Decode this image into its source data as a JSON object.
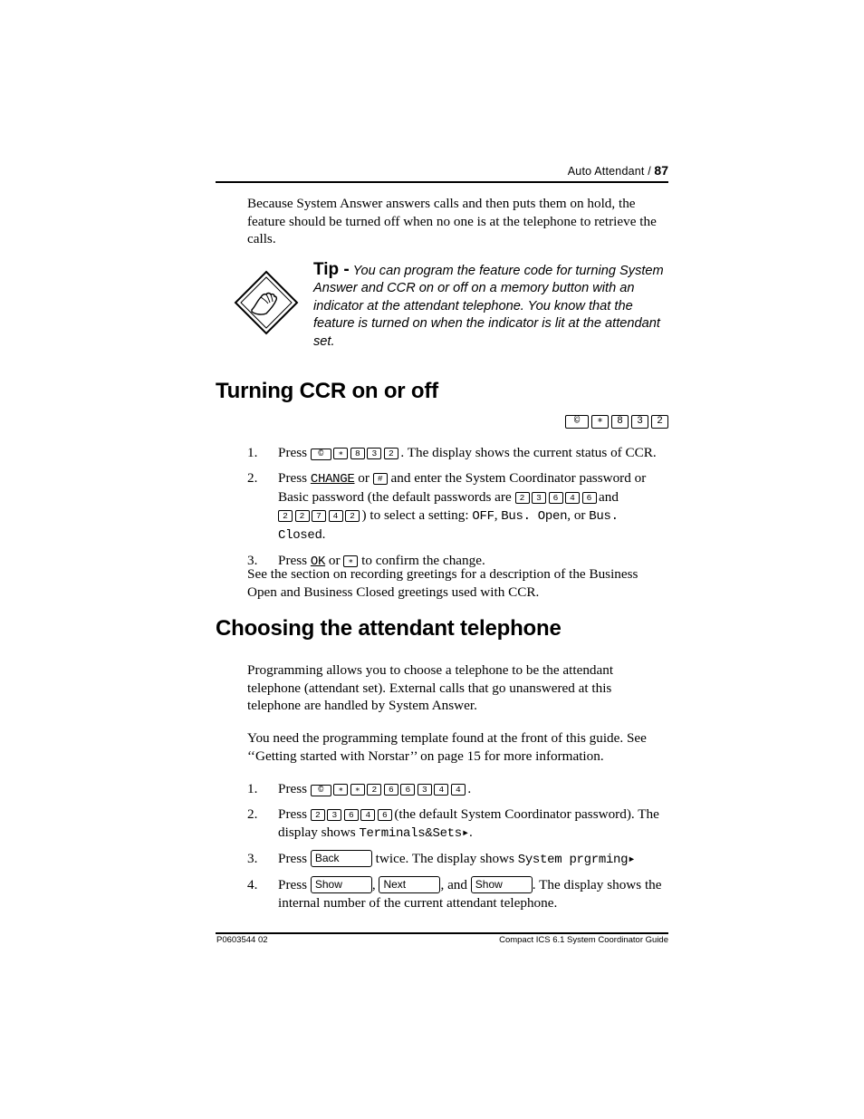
{
  "header": {
    "title": "Auto Attendant /",
    "page_number": "87"
  },
  "intro": {
    "paragraph": "Because System Answer answers calls and then puts them on hold, the feature should be turned off when no one is at the telephone to retrieve the calls."
  },
  "tip": {
    "label": "Tip -",
    "icon": "tip-hand-pointing-icon",
    "text": "You can program the feature code for turning System Answer and CCR on or off on a memory button with an indicator at the attendant telephone. You know that the feature is turned on when the indicator is lit at the attendant set."
  },
  "section_ccr": {
    "heading": "Turning CCR on or off",
    "feature_code_strip": [
      "©",
      "∗",
      "8",
      "3",
      "2"
    ],
    "steps": [
      {
        "num": "1.",
        "press": "Press",
        "keys": [
          "©",
          "∗",
          "8",
          "3",
          "2"
        ],
        "tail": ". The display shows the current status of CCR."
      },
      {
        "num": "2.",
        "press": "Press",
        "softkey": "CHANGE",
        "or": "or",
        "key_hash": "#",
        "mid": "and enter the System Coordinator password or Basic password (the default passwords are",
        "pw1": [
          "2",
          "3",
          "6",
          "4",
          "6"
        ],
        "and": "and",
        "pw2": [
          "2",
          "2",
          "7",
          "4",
          "2"
        ],
        "tail": ") to select a setting:",
        "options": [
          "OFF",
          "Bus. Open",
          "Bus. Closed"
        ],
        "end": "."
      },
      {
        "num": "3.",
        "press": "Press",
        "softkey": "OK",
        "or": "or",
        "key_star": "∗",
        "tail": "to confirm the change."
      }
    ],
    "note": "See the section on recording greetings for a description of the Business Open and Business Closed greetings used with CCR."
  },
  "section_attendant": {
    "heading": "Choosing the attendant telephone",
    "paragraph1": "Programming allows you to choose a telephone to be the attendant telephone (attendant set). External calls that go unanswered at this telephone are handled by System Answer.",
    "paragraph2": "You need the programming template found at the front of this guide. See ‘‘Getting started with Norstar’’ on page 15 for more information.",
    "steps": [
      {
        "num": "1.",
        "press": "Press",
        "keys": [
          "©",
          "∗",
          "∗",
          "2",
          "6",
          "6",
          "3",
          "4",
          "4"
        ],
        "tail": "."
      },
      {
        "num": "2.",
        "press": "Press",
        "keys": [
          "2",
          "3",
          "6",
          "4",
          "6"
        ],
        "mid": "(the default System Coordinator password). The display shows",
        "display": "Terminals&Sets▸",
        "tail": "."
      },
      {
        "num": "3.",
        "press": "Press",
        "softkey": "Back",
        "mid": "twice. The display shows",
        "display": "System prgrming▸",
        "tail": ""
      },
      {
        "num": "4.",
        "press": "Press",
        "softkeys": [
          "Show",
          "Next",
          "Show"
        ],
        "sep1": ",",
        "sep2": ", and",
        "tail": ". The display shows the internal number of the current attendant telephone."
      }
    ]
  },
  "footer": {
    "left": "P0603544   02",
    "right": "Compact ICS 6.1 System Coordinator Guide"
  }
}
